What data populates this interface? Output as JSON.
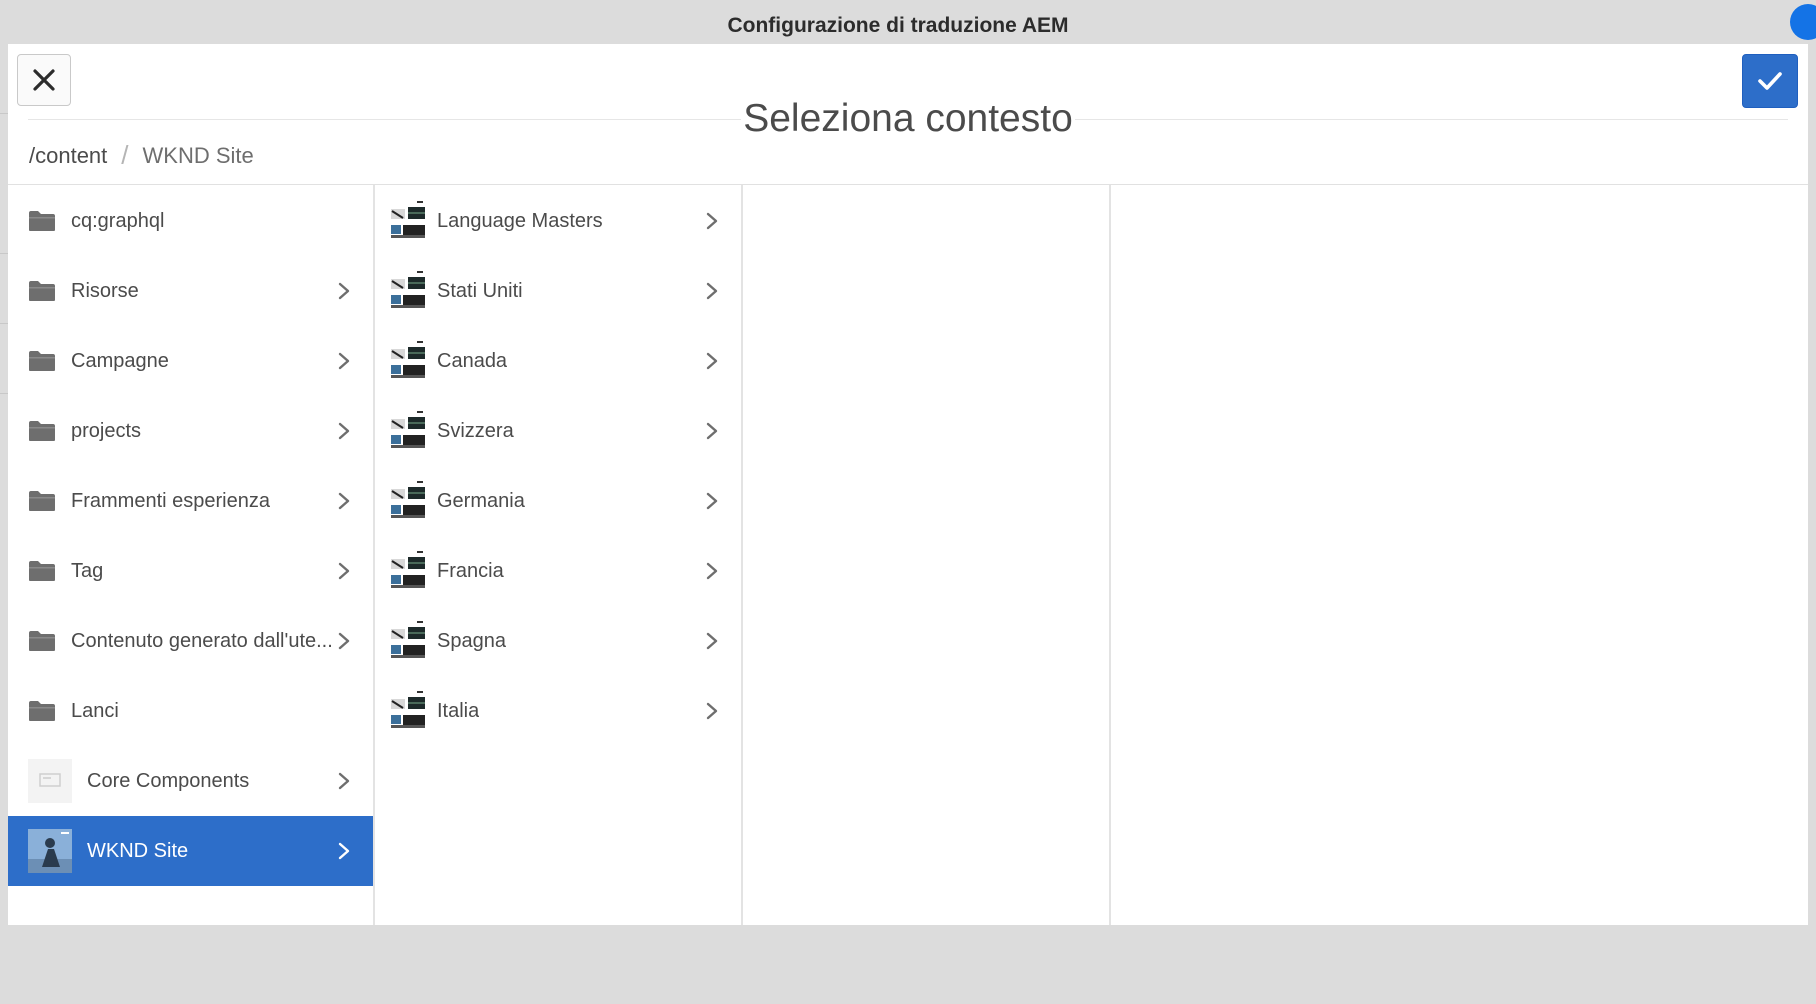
{
  "window": {
    "title": "Configurazione di traduzione AEM"
  },
  "dialog": {
    "title": "Seleziona contesto",
    "breadcrumb": {
      "root": "/content",
      "separator": "/",
      "current": "WKND Site"
    },
    "close_icon": "close-icon",
    "confirm_icon": "checkmark-icon"
  },
  "column1": {
    "items": [
      {
        "label": "cq:graphql",
        "icon": "folder-icon",
        "has_children": false
      },
      {
        "label": "Risorse",
        "icon": "folder-icon",
        "has_children": true
      },
      {
        "label": "Campagne",
        "icon": "folder-icon",
        "has_children": true
      },
      {
        "label": "projects",
        "icon": "folder-icon",
        "has_children": true
      },
      {
        "label": "Frammenti esperienza",
        "icon": "folder-icon",
        "has_children": true
      },
      {
        "label": "Tag",
        "icon": "folder-icon",
        "has_children": true
      },
      {
        "label": "Contenuto generato dall'ute...",
        "icon": "folder-icon",
        "has_children": true
      },
      {
        "label": "Lanci",
        "icon": "folder-icon",
        "has_children": false
      },
      {
        "label": "Core Components",
        "icon": "page-thumbnail-icon",
        "has_children": true
      },
      {
        "label": "WKND Site",
        "icon": "site-thumbnail-icon",
        "has_children": true,
        "selected": true
      }
    ]
  },
  "column2": {
    "items": [
      {
        "label": "Language Masters",
        "icon": "page-thumbnail-icon"
      },
      {
        "label": "Stati Uniti",
        "icon": "page-thumbnail-icon"
      },
      {
        "label": "Canada",
        "icon": "page-thumbnail-icon"
      },
      {
        "label": "Svizzera",
        "icon": "page-thumbnail-icon"
      },
      {
        "label": "Germania",
        "icon": "page-thumbnail-icon"
      },
      {
        "label": "Francia",
        "icon": "page-thumbnail-icon"
      },
      {
        "label": "Spagna",
        "icon": "page-thumbnail-icon"
      },
      {
        "label": "Italia",
        "icon": "page-thumbnail-icon"
      }
    ]
  },
  "colors": {
    "accent": "#2d6ec9",
    "background": "#dcdcdc",
    "text": "#4b4b4b"
  }
}
